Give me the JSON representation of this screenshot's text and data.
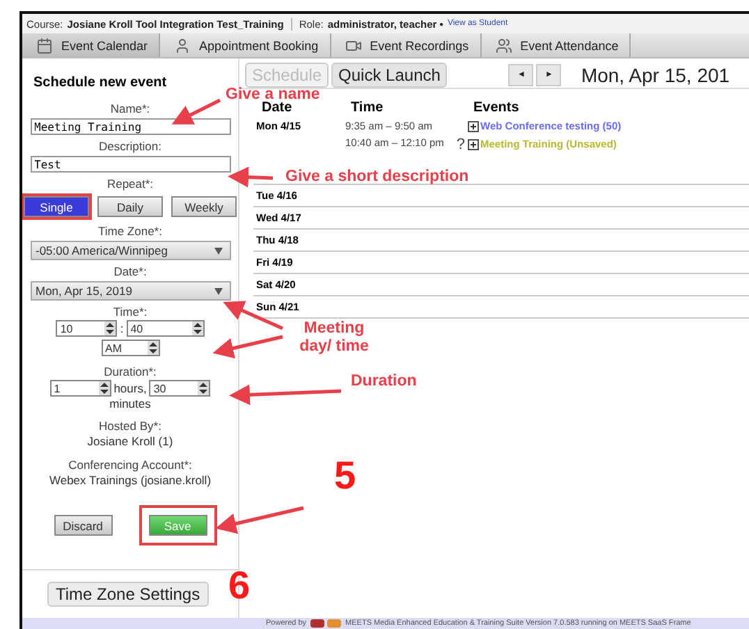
{
  "course_bar": {
    "course_label": "Course:",
    "course": "Josiane Kroll Tool Integration Test_Training",
    "role_label": "Role:",
    "role": "administrator, teacher •",
    "link": "View as Student"
  },
  "tabs": [
    {
      "label": "Event Calendar",
      "selected": true
    },
    {
      "label": "Appointment Booking",
      "selected": false
    },
    {
      "label": "Event Recordings",
      "selected": false
    },
    {
      "label": "Event Attendance",
      "selected": false
    }
  ],
  "form": {
    "title": "Schedule new event",
    "name_label": "Name*:",
    "name_value": "Meeting Training",
    "description_label": "Description:",
    "description_value": "Test",
    "repeat_label": "Repeat*:",
    "repeat_options": [
      {
        "label": "Single",
        "selected": true,
        "highlighted": true
      },
      {
        "label": "Daily",
        "selected": false,
        "highlighted": false
      },
      {
        "label": "Weekly",
        "selected": false,
        "highlighted": false
      }
    ],
    "timezone_label": "Time Zone*:",
    "timezone": "-05:00 America/Winnipeg",
    "date_label": "Date*:",
    "date": "Mon, Apr 15, 2019",
    "time_label": "Time*:",
    "hour": "10",
    "separator": ":",
    "minute": "40",
    "ampm": "AM",
    "duration_label": "Duration*:",
    "duration_hours": "1",
    "hours_unit": "hours,",
    "duration_minutes": "30",
    "minutes_unit": "minutes",
    "host_label": "Hosted By*:",
    "host": "Josiane Kroll (1)",
    "account_label": "Conferencing Account*:",
    "account": "Webex Trainings (josiane.kroll)",
    "buttons": [
      {
        "label": "Discard",
        "kind": "plain",
        "highlighted": false
      },
      {
        "label": "Save",
        "kind": "primary",
        "highlighted": true
      }
    ]
  },
  "timezone_button": "Time Zone Settings",
  "toolbar": {
    "buttons": [
      {
        "label": "Schedule",
        "disabled": true
      },
      {
        "label": "Quick Launch",
        "disabled": false
      }
    ],
    "prev": "◄",
    "next": "►",
    "date": "Mon, Apr 15, 201"
  },
  "agenda": {
    "columns": [
      "Date",
      "Time",
      "Events"
    ],
    "days": [
      {
        "day": "Mon 4/15",
        "events": [
          {
            "time": "9:35 am – 9:50 am",
            "title": "Web Conference testing (50)",
            "color": "#6b6bf0"
          },
          {
            "time": "10:40 am – 12:10 pm",
            "mark": "?",
            "title": "Meeting Training (Unsaved)",
            "color": "#b8b830"
          }
        ]
      },
      {
        "day": "Tue 4/16"
      },
      {
        "day": "Wed 4/17"
      },
      {
        "day": "Thu 4/18"
      },
      {
        "day": "Fri 4/19"
      },
      {
        "day": "Sat 4/20"
      },
      {
        "day": "Sun 4/21"
      }
    ]
  },
  "footer": {
    "prefix": "Powered by",
    "text": "MEETS Media Enhanced Education & Training Suite Version 7.0.583 running on MEETS SaaS Frame"
  },
  "annotations": [
    {
      "kind": "label",
      "text": "Give a name"
    },
    {
      "kind": "label",
      "text": "Give a short description"
    },
    {
      "kind": "label",
      "text": "Meeting day/ time"
    },
    {
      "kind": "label",
      "text": "Duration"
    },
    {
      "kind": "step",
      "text": "5"
    },
    {
      "kind": "step",
      "text": "6"
    }
  ]
}
